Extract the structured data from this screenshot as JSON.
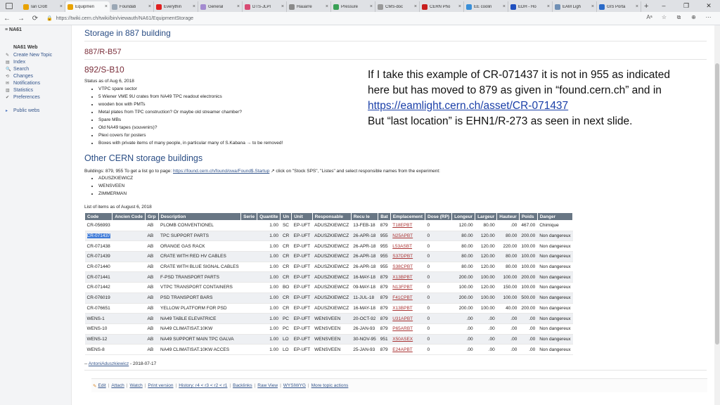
{
  "browser": {
    "tabs": [
      {
        "label": "Ian Crott",
        "color": "#e8a200"
      },
      {
        "label": "Equipmen",
        "color": "#e8a200"
      },
      {
        "label": "Foundati",
        "color": "#9aa7b5"
      },
      {
        "label": "Everythin",
        "color": "#e02020"
      },
      {
        "label": "General",
        "color": "#a38ad0"
      },
      {
        "label": "DTS-JLPI",
        "color": "#d84a73"
      },
      {
        "label": "Hauarre",
        "color": "#8a8a8a"
      },
      {
        "label": "Pressure",
        "color": "#39a055"
      },
      {
        "label": "CMS-doc",
        "color": "#999999"
      },
      {
        "label": "CERN Pho",
        "color": "#c81e1e"
      },
      {
        "label": "EE coolin",
        "color": "#3a8fd8"
      },
      {
        "label": "EDH - Ho",
        "color": "#1f4fbf"
      },
      {
        "label": "EAM Ligh",
        "color": "#6f8fb5"
      },
      {
        "label": "GIS Porta",
        "color": "#2a6ac8"
      }
    ],
    "active_tab": 1,
    "new_tab": "+",
    "close_glyph": "×",
    "url": "https://twiki.cern.ch/twiki/bin/viewauth/NA61/EquipmentStorage",
    "window_controls": [
      "–",
      "❐",
      "✕"
    ],
    "nav": [
      "←",
      "→",
      "⟳"
    ],
    "addr_icons": [
      "Aᵃ",
      "☆",
      "⧉",
      "⊕",
      "⋯"
    ]
  },
  "sidebar": {
    "web_label": "NA61",
    "title": "NA61 Web",
    "items": [
      {
        "label": "Create New Topic",
        "icon": "✎"
      },
      {
        "label": "Index",
        "icon": "▤"
      },
      {
        "label": "Search",
        "icon": "🔍"
      },
      {
        "label": "Changes",
        "icon": "⟲"
      },
      {
        "label": "Notifications",
        "icon": "✉"
      },
      {
        "label": "Statistics",
        "icon": "▥"
      },
      {
        "label": "Preferences",
        "icon": "✔"
      }
    ],
    "public_webs": "Public webs"
  },
  "content": {
    "heading_storage": "Storage in 887 building",
    "room1": "887/R-B57",
    "room2": "892/S-B10",
    "status": "Status as of Aug 6, 2018",
    "room2_items": [
      "VTPC spare sector",
      "5 Wiener VME 9U crates from NA49 TPC readout electronics",
      "wooden box with PMTs",
      "Metal plates from TPC construction? Or maybe old streamer chamber?",
      "Spare MBs",
      "Old NA49 tapes (souvenirs)?",
      "Plexi covers for posters",
      "Boxes with private items of many people, in particular many of S.Kabana → to be removed!"
    ],
    "heading_other": "Other CERN storage buildings",
    "buildings_prefix": "Buildings: 879, 955 To get a list go to page: ",
    "buildings_link": "https://found.cern.ch/found/owa/Found$.Startup",
    "buildings_suffix": " click on \"Stock SPS\", \"Listes\" and select responsible names from the experiment:",
    "responsibles": [
      "ADUSZKIEWICZ",
      "WENSVEEN",
      "ZIMMERMAN"
    ],
    "list_of": "List of items as of August 6, 2018",
    "signature_prefix": "-- ",
    "signature_name": "AntoniAduszkiewicz",
    "signature_date": " - 2018-07-17"
  },
  "table": {
    "headers": [
      "Code",
      "Ancien Code",
      "Grp",
      "Description",
      "Serie",
      "Quantite",
      "Un",
      "Unit",
      "Responsable",
      "Recu le",
      "Bat",
      "Emplacement",
      "Dose (RP)",
      "Longeur",
      "Largeur",
      "Hauteur",
      "Poids",
      "Danger"
    ],
    "rows": [
      [
        "CR-056993",
        "",
        "AB",
        "PLOMB CONVENTIONEL",
        "",
        "1.00",
        "SC",
        "EP-UFT",
        "ADUSZKIEWICZ",
        "13-FEB-18",
        "879",
        "T18EPBT",
        "0",
        "120.00",
        "80.00",
        ".00",
        "467.00",
        "Chimique"
      ],
      [
        "CR-071437",
        "",
        "AB",
        "TPC SUPPORT PARTS",
        "",
        "1.00",
        "CR",
        "EP-UFT",
        "ADUSZKIEWICZ",
        "26-APR-18",
        "955",
        "N25APBT",
        "0",
        "80.00",
        "120.00",
        "80.00",
        "200.00",
        "Non dangereux"
      ],
      [
        "CR-071438",
        "",
        "AB",
        "ORANGE GAS RACK",
        "",
        "1.00",
        "CR",
        "EP-UFT",
        "ADUSZKIEWICZ",
        "26-APR-18",
        "955",
        "L53ASBT",
        "0",
        "80.00",
        "120.00",
        "220.00",
        "100.00",
        "Non dangereux"
      ],
      [
        "CR-071439",
        "",
        "AB",
        "CRATE WITH RED HV CABLES",
        "",
        "1.00",
        "CR",
        "EP-UFT",
        "ADUSZKIEWICZ",
        "26-APR-18",
        "955",
        "S37DPBT",
        "0",
        "80.00",
        "120.00",
        "80.00",
        "100.00",
        "Non dangereux"
      ],
      [
        "CR-071440",
        "",
        "AB",
        "CRATE WITH BLUE SIGNAL CABLES",
        "",
        "1.00",
        "CR",
        "EP-UFT",
        "ADUSZKIEWICZ",
        "26-APR-18",
        "955",
        "S38CPBT",
        "0",
        "80.00",
        "120.00",
        "80.00",
        "100.00",
        "Non dangereux"
      ],
      [
        "CR-071441",
        "",
        "AB",
        "F-PSD TRANSPORT PARTS",
        "",
        "1.00",
        "CR",
        "EP-UFT",
        "ADUSZKIEWICZ",
        "16-MAY-18",
        "879",
        "X13BPBT",
        "0",
        "200.00",
        "100.00",
        "100.00",
        "200.00",
        "Non dangereux"
      ],
      [
        "CR-071442",
        "",
        "AB",
        "VTPC TRANSPORT CONTAINERS",
        "",
        "1.00",
        "BO",
        "EP-UFT",
        "ADUSZKIEWICZ",
        "09-MAY-18",
        "879",
        "N13FPBT",
        "0",
        "100.00",
        "120.00",
        "150.00",
        "100.00",
        "Non dangereux"
      ],
      [
        "CR-076019",
        "",
        "AB",
        "PSD TRANSPORT BARS",
        "",
        "1.00",
        "CR",
        "EP-UFT",
        "ADUSZKIEWICZ",
        "11-JUL-18",
        "879",
        "F41CPBT",
        "0",
        "200.00",
        "100.00",
        "100.00",
        "500.00",
        "Non dangereux"
      ],
      [
        "CR-076651",
        "",
        "AB",
        "YELLOW PLATFORM FOR PSD",
        "",
        "1.00",
        "CR",
        "EP-UFT",
        "ADUSZKIEWICZ",
        "16-MAY-18",
        "879",
        "X13BPBT",
        "0",
        "200.00",
        "100.00",
        "40.00",
        "200.00",
        "Non dangereux"
      ],
      [
        "WENS-1",
        "",
        "AB",
        "NA49 TABLE ELEVATRICE",
        "",
        "1.00",
        "PC",
        "EP-UFT",
        "WENSVEEN",
        "20-OCT-92",
        "879",
        "U31APBT",
        "0",
        ".00",
        ".00",
        ".00",
        ".00",
        "Non dangereux"
      ],
      [
        "WENS-10",
        "",
        "AB",
        "NA49 CLIMATISAT.10KW",
        "",
        "1.00",
        "PC",
        "EP-UFT",
        "WENSVEEN",
        "26-JAN-93",
        "879",
        "P65ARBT",
        "0",
        ".00",
        ".00",
        ".00",
        ".00",
        "Non dangereux"
      ],
      [
        "WENS-12",
        "",
        "AB",
        "NA49 SUPPORT MAIN TPC GALVA",
        "",
        "1.00",
        "LO",
        "EP-UFT",
        "WENSVEEN",
        "30-NOV-95",
        "951",
        "X50ASEX",
        "0",
        ".00",
        ".00",
        ".00",
        ".00",
        "Non dangereux"
      ],
      [
        "WENS-8",
        "",
        "AB",
        "NA49 CLIMATISAT.10KW ACCES",
        "",
        "1.00",
        "LO",
        "EP-UFT",
        "WENSVEEN",
        "25-JAN-93",
        "879",
        "E24APBT",
        "0",
        ".00",
        ".00",
        ".00",
        ".00",
        "Non dangereux"
      ]
    ],
    "selected_code_row": 1
  },
  "actions": {
    "items": [
      "Edit",
      "Attach",
      "Watch",
      "Print version",
      "History: r4 < r3 < r2 < r1",
      "Backlinks",
      "Raw View",
      "WYSIWYG",
      "More topic actions"
    ]
  },
  "annotation": {
    "line1": "If I take this example of CR-071437 it is not in 955 as indicated here but has moved to 879 as given in “found.cern.ch” and in",
    "link": "https://eamlight.cern.ch/asset/CR-071437",
    "line2": "But “last location” is EHN1/R-273 as seen in next slide."
  }
}
